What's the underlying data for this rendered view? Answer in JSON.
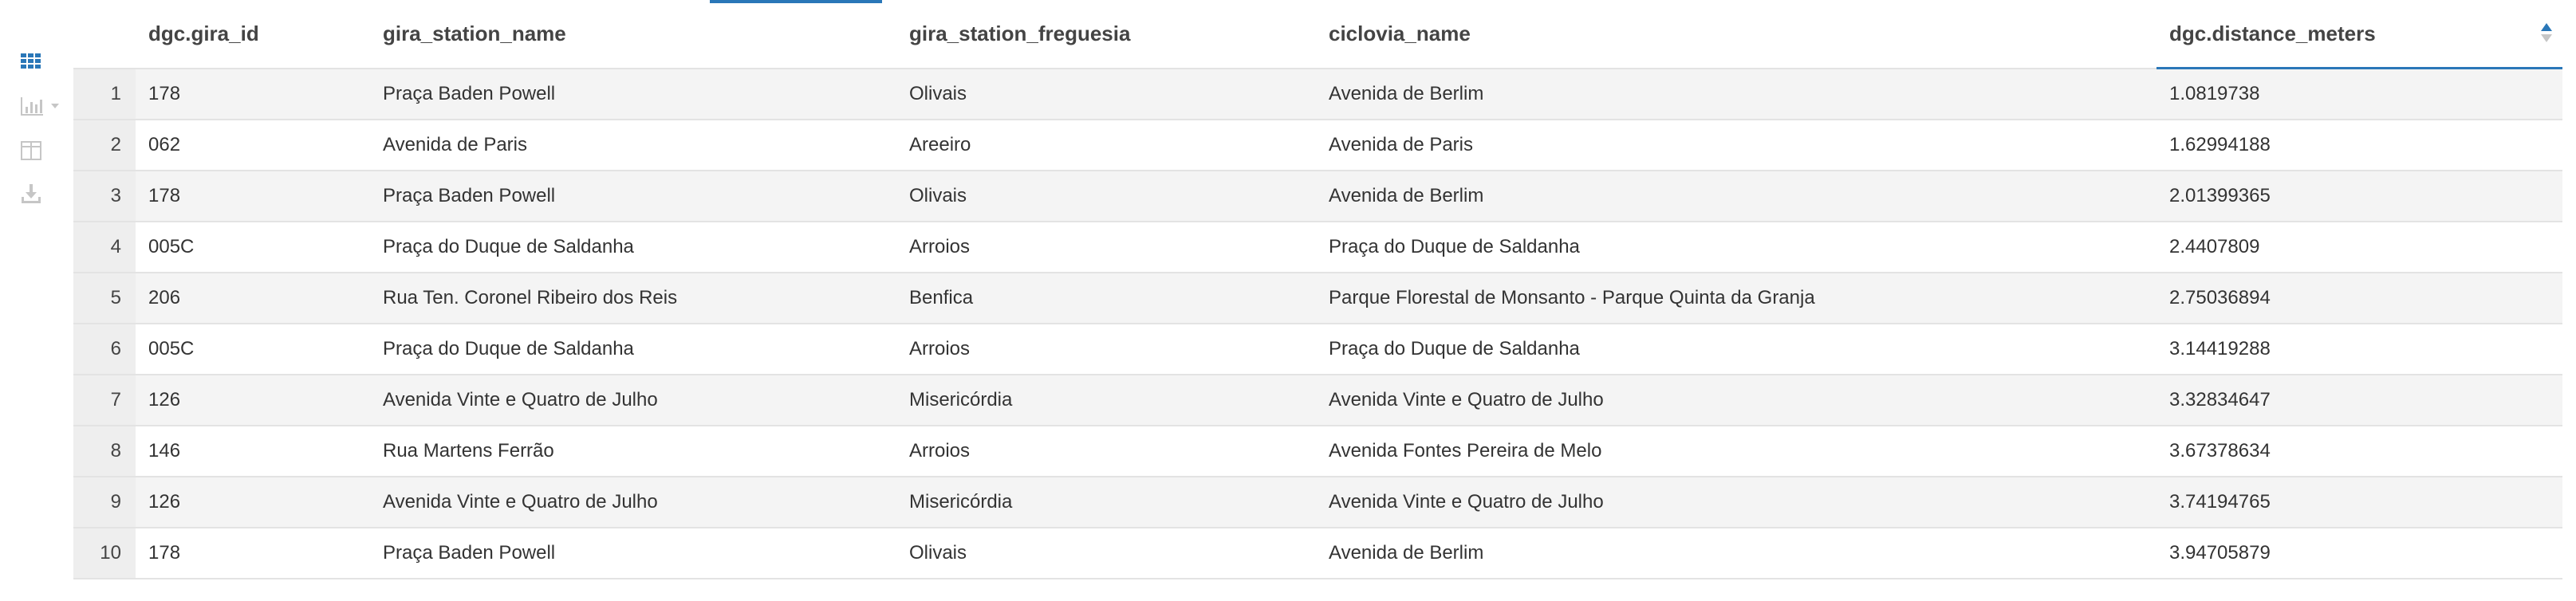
{
  "toolbar": {
    "icons": [
      "grid-icon",
      "chart-icon",
      "columns-icon",
      "download-icon"
    ],
    "accent": "#2a77b8"
  },
  "table": {
    "columns": [
      "dgc.gira_id",
      "gira_station_name",
      "gira_station_freguesia",
      "ciclovia_name",
      "dgc.distance_meters"
    ],
    "sorted_column": "dgc.distance_meters",
    "sort_direction": "ascending",
    "rows": [
      {
        "n": "1",
        "id": "178",
        "station": "Praça Baden Powell",
        "freguesia": "Olivais",
        "ciclovia": "Avenida de Berlim",
        "distance": "1.0819738"
      },
      {
        "n": "2",
        "id": "062",
        "station": "Avenida de Paris",
        "freguesia": "Areeiro",
        "ciclovia": "Avenida de Paris",
        "distance": "1.62994188"
      },
      {
        "n": "3",
        "id": "178",
        "station": "Praça Baden Powell",
        "freguesia": "Olivais",
        "ciclovia": "Avenida de Berlim",
        "distance": "2.01399365"
      },
      {
        "n": "4",
        "id": "005C",
        "station": "Praça do Duque de Saldanha",
        "freguesia": "Arroios",
        "ciclovia": "Praça do Duque de Saldanha",
        "distance": "2.4407809"
      },
      {
        "n": "5",
        "id": "206",
        "station": "Rua Ten. Coronel Ribeiro dos Reis",
        "freguesia": "Benfica",
        "ciclovia": "Parque Florestal de Monsanto - Parque Quinta da Granja",
        "distance": "2.75036894"
      },
      {
        "n": "6",
        "id": "005C",
        "station": "Praça do Duque de Saldanha",
        "freguesia": "Arroios",
        "ciclovia": "Praça do Duque de Saldanha",
        "distance": "3.14419288"
      },
      {
        "n": "7",
        "id": "126",
        "station": "Avenida Vinte e Quatro de Julho",
        "freguesia": "Misericórdia",
        "ciclovia": "Avenida Vinte e Quatro de Julho",
        "distance": "3.32834647"
      },
      {
        "n": "8",
        "id": "146",
        "station": "Rua Martens Ferrão",
        "freguesia": "Arroios",
        "ciclovia": "Avenida Fontes Pereira de Melo",
        "distance": "3.67378634"
      },
      {
        "n": "9",
        "id": "126",
        "station": "Avenida Vinte e Quatro de Julho",
        "freguesia": "Misericórdia",
        "ciclovia": "Avenida Vinte e Quatro de Julho",
        "distance": "3.74194765"
      },
      {
        "n": "10",
        "id": "178",
        "station": "Praça Baden Powell",
        "freguesia": "Olivais",
        "ciclovia": "Avenida de Berlim",
        "distance": "3.94705879"
      }
    ]
  }
}
